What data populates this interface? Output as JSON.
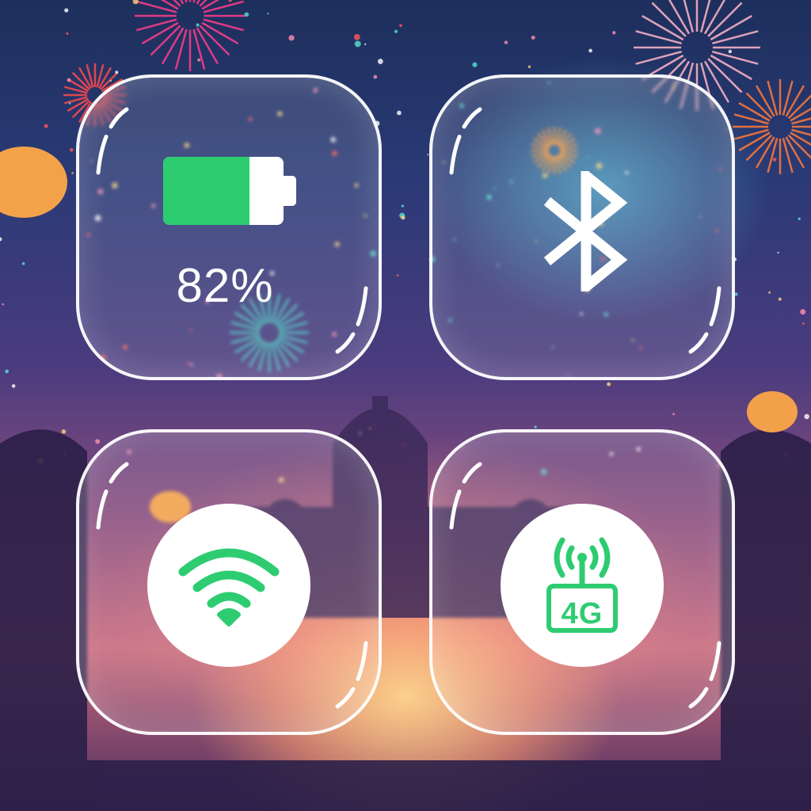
{
  "control_center": {
    "battery": {
      "percent_label": "82%",
      "level": 0.72,
      "fill_color": "#2ecc71",
      "icon": "battery-icon"
    },
    "bluetooth": {
      "icon": "bluetooth-icon",
      "state": "off"
    },
    "wifi": {
      "icon": "wifi-icon",
      "state": "on",
      "color": "#2ecc71"
    },
    "cellular": {
      "icon": "cellular-4g-icon",
      "network_label": "4G",
      "state": "on",
      "color": "#2ecc71"
    }
  },
  "wallpaper": {
    "theme": "night festival fireworks"
  }
}
